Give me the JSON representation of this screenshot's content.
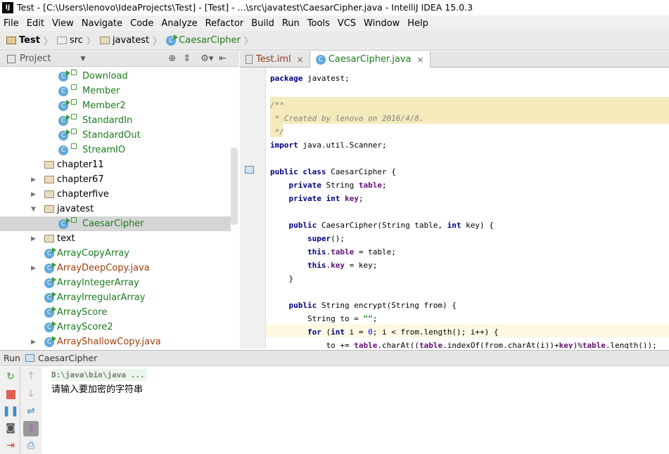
{
  "window": {
    "title": "Test - [C:\\Users\\lenovo\\IdeaProjects\\Test] - [Test] - ...\\src\\javatest\\CaesarCipher.java - IntelliJ IDEA 15.0.3",
    "logo": "IJ"
  },
  "menu": [
    "File",
    "Edit",
    "View",
    "Navigate",
    "Code",
    "Analyze",
    "Refactor",
    "Build",
    "Run",
    "Tools",
    "VCS",
    "Window",
    "Help"
  ],
  "breadcrumb": [
    "Test",
    "src",
    "javatest",
    "CaesarCipher"
  ],
  "project_panel": {
    "title": "Project"
  },
  "tree": [
    {
      "label": "Download",
      "kind": "class",
      "run": true,
      "depth": 2
    },
    {
      "label": "Member",
      "kind": "class",
      "run": false,
      "depth": 2
    },
    {
      "label": "Member2",
      "kind": "class",
      "run": true,
      "depth": 2
    },
    {
      "label": "StandardIn",
      "kind": "class",
      "run": true,
      "depth": 2
    },
    {
      "label": "StandardOut",
      "kind": "class",
      "run": true,
      "depth": 2
    },
    {
      "label": "StreamIO",
      "kind": "class",
      "run": false,
      "depth": 2
    },
    {
      "label": "chapter11",
      "kind": "folder",
      "arrow": "",
      "depth": 1
    },
    {
      "label": "chapter67",
      "kind": "folder",
      "arrow": "right",
      "depth": 1
    },
    {
      "label": "chapterfive",
      "kind": "folder",
      "arrow": "right",
      "depth": 1
    },
    {
      "label": "javatest",
      "kind": "folder",
      "arrow": "down",
      "depth": 1
    },
    {
      "label": "CaesarCipher",
      "kind": "class",
      "run": true,
      "depth": 2,
      "selected": true
    },
    {
      "label": "text",
      "kind": "folder",
      "arrow": "right",
      "depth": 1
    },
    {
      "label": "ArrayCopyArray",
      "kind": "class1",
      "run": true
    },
    {
      "label": "ArrayDeepCopy.java",
      "kind": "file",
      "arrow": "right"
    },
    {
      "label": "ArrayIntegerArray",
      "kind": "class1",
      "run": true
    },
    {
      "label": "ArrayIrregularArray",
      "kind": "class1",
      "run": true
    },
    {
      "label": "ArrayScore",
      "kind": "class1",
      "run": true
    },
    {
      "label": "ArrayScore2",
      "kind": "class1",
      "run": true
    },
    {
      "label": "ArrayShallowCopy.java",
      "kind": "file",
      "arrow": "right"
    }
  ],
  "tabs": [
    {
      "label": "Test.iml",
      "active": false
    },
    {
      "label": "CaesarCipher.java",
      "active": true
    }
  ],
  "code": [
    [
      [
        "package",
        "kw"
      ],
      [
        " javatest;",
        ""
      ]
    ],
    [],
    [
      [
        "/**",
        "cm"
      ]
    ],
    [
      [
        " * Created by lenovo on 2016/4/8.",
        "cm"
      ]
    ],
    [
      [
        " */",
        "cm"
      ]
    ],
    [
      [
        "import",
        "kw"
      ],
      [
        " java.util.Scanner;",
        ""
      ]
    ],
    [],
    [
      [
        "public class",
        "kw"
      ],
      [
        " CaesarCipher {",
        ""
      ]
    ],
    [
      [
        "    private",
        "kw"
      ],
      [
        " String ",
        ""
      ],
      [
        "table",
        "fld"
      ],
      [
        ";",
        ""
      ]
    ],
    [
      [
        "    private int",
        "kw"
      ],
      [
        " ",
        ""
      ],
      [
        "key",
        "fld"
      ],
      [
        ";",
        ""
      ]
    ],
    [],
    [
      [
        "    public",
        "kw"
      ],
      [
        " CaesarCipher(String table, ",
        ""
      ],
      [
        "int",
        "kw"
      ],
      [
        " key) {",
        ""
      ]
    ],
    [
      [
        "        super",
        "kw"
      ],
      [
        "();",
        ""
      ]
    ],
    [
      [
        "        this",
        "kw"
      ],
      [
        ".",
        ""
      ],
      [
        "table",
        "fld"
      ],
      [
        " = table;",
        ""
      ]
    ],
    [
      [
        "        this",
        "kw"
      ],
      [
        ".",
        ""
      ],
      [
        "key",
        "fld"
      ],
      [
        " = key;",
        ""
      ]
    ],
    [
      [
        "    }",
        ""
      ]
    ],
    [],
    [
      [
        "    public",
        "kw"
      ],
      [
        " String encrypt(String from) {",
        ""
      ]
    ],
    [
      [
        "        String to = ",
        ""
      ],
      [
        "\"\"",
        "str"
      ],
      [
        ";",
        ""
      ]
    ],
    [
      [
        "        for",
        "kw"
      ],
      [
        " (",
        ""
      ],
      [
        "int",
        "kw"
      ],
      [
        " i = ",
        ""
      ],
      [
        "0",
        "num"
      ],
      [
        "; i < from.length(); i++) {",
        ""
      ]
    ],
    [
      [
        "            to += ",
        ""
      ],
      [
        "table",
        "fld"
      ],
      [
        ".charAt((",
        ""
      ],
      [
        "table",
        "fld"
      ],
      [
        ".indexOf(from.charAt(i))+",
        ""
      ],
      [
        "key",
        "fld"
      ],
      [
        ")%",
        ""
      ],
      [
        "table",
        "fld"
      ],
      [
        ".length());",
        ""
      ]
    ]
  ],
  "run": {
    "label": "Run",
    "config": "CaesarCipher"
  },
  "console": [
    "D:\\java\\bin\\java ...",
    "请输入要加密的字符串"
  ]
}
